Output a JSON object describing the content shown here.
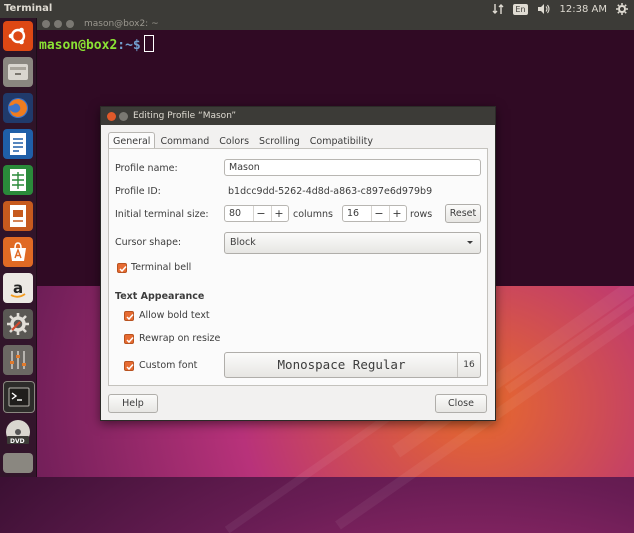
{
  "top_panel": {
    "app_title": "Terminal",
    "keyboard_layout": "En",
    "clock": "12:38 AM"
  },
  "launcher": {
    "items": [
      {
        "icon": "ubuntu-dash-icon"
      },
      {
        "icon": "files-icon"
      },
      {
        "icon": "firefox-icon"
      },
      {
        "icon": "writer-icon"
      },
      {
        "icon": "calc-icon"
      },
      {
        "icon": "impress-icon"
      },
      {
        "icon": "software-center-icon"
      },
      {
        "icon": "amazon-icon"
      },
      {
        "icon": "system-settings-icon"
      },
      {
        "icon": "mixer-icon"
      },
      {
        "icon": "terminal-icon"
      },
      {
        "icon": "dvd-icon"
      }
    ]
  },
  "terminal": {
    "window_title": "mason@box2: ~",
    "prompt_user": "mason@box2",
    "prompt_path": ":~$"
  },
  "dialog": {
    "title": "Editing Profile “Mason”",
    "tabs": [
      "General",
      "Command",
      "Colors",
      "Scrolling",
      "Compatibility"
    ],
    "active_tab": "General",
    "profile_name_label": "Profile name:",
    "profile_name_value": "Mason",
    "profile_id_label": "Profile ID:",
    "profile_id_value": "b1dcc9dd-5262-4d8d-a863-c897e6d979b9",
    "initial_size_label": "Initial terminal size:",
    "columns_value": "80",
    "columns_label": "columns",
    "rows_value": "16",
    "rows_label": "rows",
    "minus": "−",
    "plus": "+",
    "reset_label": "Reset",
    "cursor_shape_label": "Cursor shape:",
    "cursor_shape_value": "Block",
    "terminal_bell_label": "Terminal bell",
    "terminal_bell_checked": true,
    "text_appearance_heading": "Text Appearance",
    "allow_bold_label": "Allow bold text",
    "allow_bold_checked": true,
    "rewrap_label": "Rewrap on resize",
    "rewrap_checked": true,
    "custom_font_label": "Custom font",
    "custom_font_checked": true,
    "font_name": "Monospace Regular",
    "font_size": "16",
    "help_label": "Help",
    "close_label": "Close"
  },
  "colors": {
    "accent": "#e66b32",
    "panel": "#3c3b37",
    "terminal_bg": "#300a24",
    "prompt_user": "#8ae234",
    "prompt_path": "#729fcf"
  }
}
